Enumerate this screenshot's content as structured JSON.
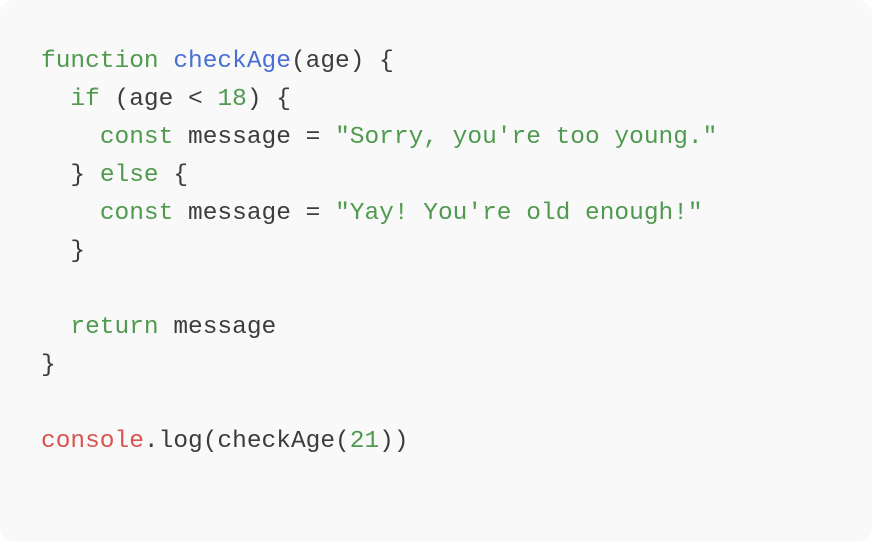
{
  "code": {
    "lines": [
      [
        {
          "t": "function",
          "c": "kw"
        },
        {
          "t": " ",
          "c": "plain"
        },
        {
          "t": "checkAge",
          "c": "fn"
        },
        {
          "t": "(age) {",
          "c": "plain"
        }
      ],
      [
        {
          "t": "  ",
          "c": "plain"
        },
        {
          "t": "if",
          "c": "kw"
        },
        {
          "t": " (age < ",
          "c": "plain"
        },
        {
          "t": "18",
          "c": "num"
        },
        {
          "t": ") {",
          "c": "plain"
        }
      ],
      [
        {
          "t": "    ",
          "c": "plain"
        },
        {
          "t": "const",
          "c": "kw"
        },
        {
          "t": " message = ",
          "c": "plain"
        },
        {
          "t": "\"Sorry, you're too young.\"",
          "c": "str"
        }
      ],
      [
        {
          "t": "  } ",
          "c": "plain"
        },
        {
          "t": "else",
          "c": "kw"
        },
        {
          "t": " {",
          "c": "plain"
        }
      ],
      [
        {
          "t": "    ",
          "c": "plain"
        },
        {
          "t": "const",
          "c": "kw"
        },
        {
          "t": " message = ",
          "c": "plain"
        },
        {
          "t": "\"Yay! You're old enough!\"",
          "c": "str"
        }
      ],
      [
        {
          "t": "  }",
          "c": "plain"
        }
      ],
      [],
      [
        {
          "t": "  ",
          "c": "plain"
        },
        {
          "t": "return",
          "c": "kw"
        },
        {
          "t": " message",
          "c": "plain"
        }
      ],
      [
        {
          "t": "}",
          "c": "plain"
        }
      ],
      [],
      [
        {
          "t": "console",
          "c": "obj"
        },
        {
          "t": ".log(checkAge(",
          "c": "plain"
        },
        {
          "t": "21",
          "c": "num"
        },
        {
          "t": "))",
          "c": "plain"
        }
      ]
    ]
  },
  "colors": {
    "background": "#f9f9f9",
    "keyword": "#4f9a4f",
    "function_name": "#4a6fd4",
    "number": "#4f9a4f",
    "string": "#4f9a4f",
    "object": "#d9534f",
    "plain": "#3c3c3c"
  }
}
